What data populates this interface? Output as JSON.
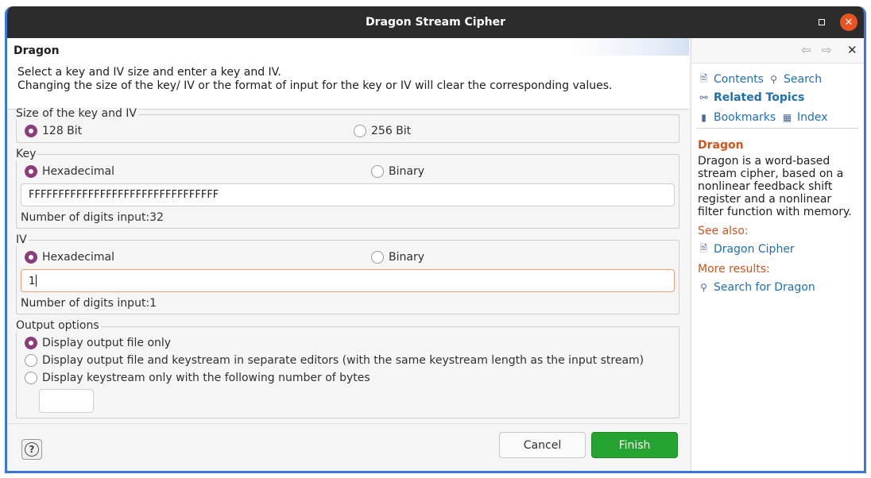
{
  "window": {
    "title": "Dragon Stream Cipher"
  },
  "header": {
    "title": "Dragon",
    "line1": "Select a key and IV size and enter a key and IV.",
    "line2": "Changing the size of the key/ IV or the format of input for the key or IV will clear the corresponding values."
  },
  "size_group": {
    "legend": "Size of the key and IV",
    "opt1": "128 Bit",
    "opt2": "256 Bit",
    "selected": "128 Bit"
  },
  "key_group": {
    "legend": "Key",
    "opt1": "Hexadecimal",
    "opt2": "Binary",
    "value": "FFFFFFFFFFFFFFFFFFFFFFFFFFFFFFFF",
    "digits": "Number of digits input:32"
  },
  "iv_group": {
    "legend": "IV",
    "opt1": "Hexadecimal",
    "opt2": "Binary",
    "value": "1",
    "digits": "Number of digits input:1"
  },
  "output_group": {
    "legend": "Output options",
    "opt1": "Display output file only",
    "opt2": "Display output file and keystream in separate editors (with the same keystream length as the input stream)",
    "opt3": "Display keystream only with the following number of bytes",
    "bytes_value": ""
  },
  "buttons": {
    "cancel": "Cancel",
    "finish": "Finish",
    "help_glyph": "?"
  },
  "help": {
    "contents": "Contents",
    "search": "Search",
    "related": "Related Topics",
    "bookmarks": "Bookmarks",
    "index": "Index",
    "heading": "Dragon",
    "body": "Dragon is a word-based stream cipher, based on a nonlinear feedback shift register and a nonlinear filter function with memory.",
    "see_also": "See also:",
    "see_link": "Dragon Cipher",
    "more": "More results:",
    "more_link": "Search for Dragon"
  },
  "colors": {
    "accent": "#8a3d7a",
    "finish": "#26a330",
    "link": "#1f6fb5",
    "help_heading": "#d2541c",
    "window_border": "#3a76d6"
  }
}
